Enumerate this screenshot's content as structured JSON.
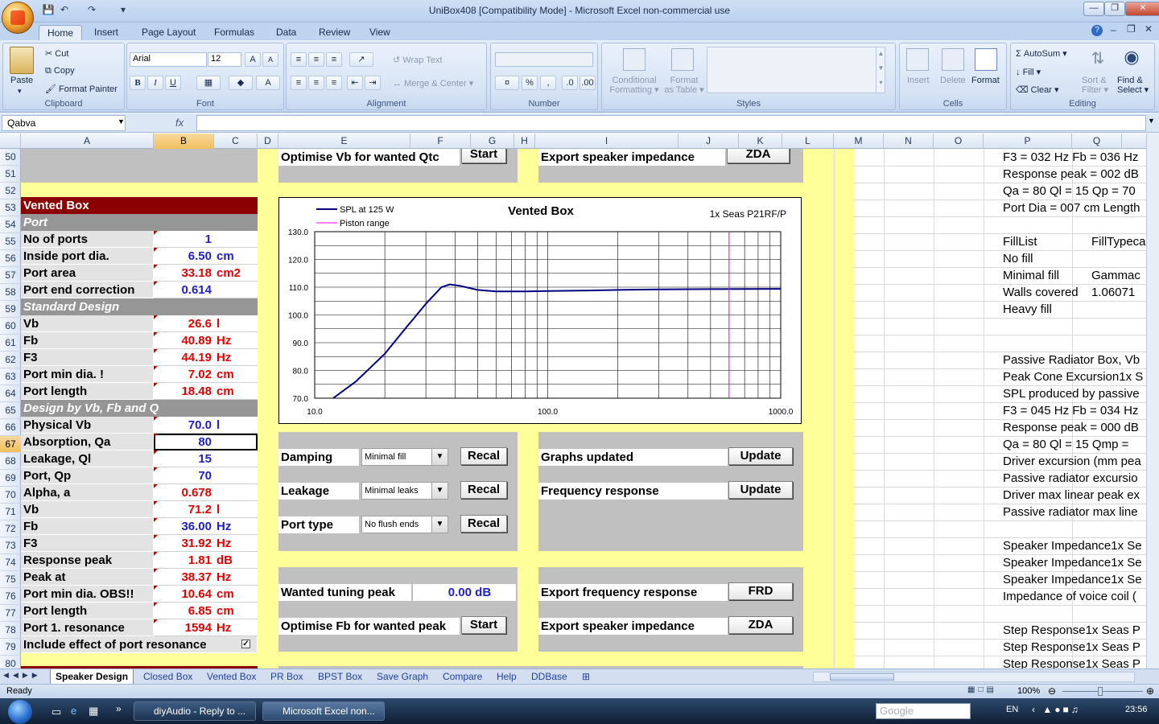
{
  "window": {
    "title": "UniBox408  [Compatibility Mode] - Microsoft Excel non-commercial use"
  },
  "ribbon": {
    "tabs": [
      "Home",
      "Insert",
      "Page Layout",
      "Formulas",
      "Data",
      "Review",
      "View"
    ],
    "clipboard": {
      "label": "Clipboard",
      "paste": "Paste",
      "cut": "Cut",
      "copy": "Copy",
      "format_painter": "Format Painter"
    },
    "font": {
      "label": "Font",
      "name": "Arial",
      "size": "12",
      "bold": "B",
      "italic": "I",
      "underline": "U"
    },
    "alignment": {
      "label": "Alignment",
      "wrap": "Wrap Text",
      "merge": "Merge & Center"
    },
    "number": {
      "label": "Number",
      "percent": "%",
      "comma": ","
    },
    "styles": {
      "label": "Styles",
      "conditional": "Conditional",
      "formatting": "Formatting",
      "format_as": "Format",
      "as_table": "as Table"
    },
    "cells": {
      "label": "Cells",
      "insert": "Insert",
      "delete": "Delete",
      "format": "Format"
    },
    "editing": {
      "label": "Editing",
      "autosum": "AutoSum",
      "fill": "Fill",
      "clear": "Clear",
      "sort": "Sort &",
      "filter": "Filter",
      "find": "Find &",
      "select": "Select"
    }
  },
  "formula_bar": {
    "name_box": "Qabva",
    "fx": "fx",
    "formula": ""
  },
  "columns": [
    "A",
    "B",
    "C",
    "D",
    "E",
    "F",
    "G",
    "H",
    "I",
    "J",
    "K",
    "L",
    "M",
    "N",
    "O",
    "P",
    "Q"
  ],
  "rows": [
    "50",
    "51",
    "52",
    "53",
    "54",
    "55",
    "56",
    "57",
    "58",
    "59",
    "60",
    "61",
    "62",
    "63",
    "64",
    "65",
    "66",
    "67",
    "68",
    "69",
    "70",
    "71",
    "72",
    "73",
    "74",
    "75",
    "76",
    "77",
    "78",
    "79",
    "80"
  ],
  "left_table": [
    {
      "type": "header_red",
      "label": "Vented Box"
    },
    {
      "type": "header_gray",
      "label": "Port"
    },
    {
      "label": "No of ports",
      "value": "1",
      "unit": "",
      "color": "blue"
    },
    {
      "label": "Inside port dia.",
      "value": "6.50",
      "unit": "cm",
      "color": "blue"
    },
    {
      "label": "Port area",
      "value": "33.18",
      "unit": "cm2",
      "color": "red"
    },
    {
      "label": "Port end correction",
      "value": "0.614",
      "unit": "",
      "color": "blue"
    },
    {
      "type": "header_gray",
      "label": "Standard Design"
    },
    {
      "label": "Vb",
      "value": "26.6",
      "unit": "l",
      "color": "red"
    },
    {
      "label": "Fb",
      "value": "40.89",
      "unit": "Hz",
      "color": "red"
    },
    {
      "label": "F3",
      "value": "44.19",
      "unit": "Hz",
      "color": "red"
    },
    {
      "label": "Port min dia. !",
      "value": "7.02",
      "unit": "cm",
      "color": "red"
    },
    {
      "label": "Port length",
      "value": "18.48",
      "unit": "cm",
      "color": "red"
    },
    {
      "type": "header_gray",
      "label": "Design by Vb, Fb and Q"
    },
    {
      "label": "Physical Vb",
      "value": "70.0",
      "unit": "l",
      "color": "blue"
    },
    {
      "label": "Absorption, Qa",
      "value": "80",
      "unit": "",
      "color": "blue",
      "selected": true
    },
    {
      "label": "Leakage, Ql",
      "value": "15",
      "unit": "",
      "color": "blue"
    },
    {
      "label": "Port, Qp",
      "value": "70",
      "unit": "",
      "color": "blue"
    },
    {
      "label": "Alpha, a",
      "value": "0.678",
      "unit": "",
      "color": "red"
    },
    {
      "label": "Vb",
      "value": "71.2",
      "unit": "l",
      "color": "red"
    },
    {
      "label": "Fb",
      "value": "36.00",
      "unit": "Hz",
      "color": "blue"
    },
    {
      "label": "F3",
      "value": "31.92",
      "unit": "Hz",
      "color": "red"
    },
    {
      "label": "Response peak",
      "value": "1.81",
      "unit": "dB",
      "color": "red"
    },
    {
      "label": "Peak at",
      "value": "38.37",
      "unit": "Hz",
      "color": "red"
    },
    {
      "label": "Port min dia. OBS!!",
      "value": "10.64",
      "unit": "cm",
      "color": "red"
    },
    {
      "label": "Port length",
      "value": "6.85",
      "unit": "cm",
      "color": "red"
    },
    {
      "label": "Port 1. resonance",
      "value": "1594",
      "unit": "Hz",
      "color": "red"
    },
    {
      "label": "Include effect of port resonance",
      "value": "",
      "unit": "",
      "color": "blue",
      "checkbox": true
    }
  ],
  "controls": {
    "optimise_vb": "Optimise Vb for wanted Qtc",
    "start": "Start",
    "export_impedance": "Export speaker impedance",
    "zda": "ZDA",
    "damping": "Damping",
    "damping_value": "Minimal fill",
    "leakage": "Leakage",
    "leakage_value": "Minimal leaks",
    "port_type": "Port type",
    "port_type_value": "No flush ends",
    "recal": "Recal",
    "graphs_updated": "Graphs updated",
    "update": "Update",
    "frequency_response": "Frequency response",
    "wanted_peak": "Wanted tuning peak",
    "wanted_peak_value": "0.00",
    "wanted_peak_unit": "dB",
    "export_freq": "Export frequency response",
    "frd": "FRD",
    "optimise_fb": "Optimise Fb for wanted peak"
  },
  "right_column": [
    {
      "row": 0,
      "text": "F3 = 032 Hz  Fb = 036 Hz"
    },
    {
      "row": 1,
      "text": "Response peak = 002 dB"
    },
    {
      "row": 2,
      "text": "Qa = 80  Ql = 15  Qp = 70"
    },
    {
      "row": 3,
      "text": "Port Dia = 007 cm  Length"
    },
    {
      "row": 5,
      "text": "FillList",
      "text2": "FillTypeca"
    },
    {
      "row": 6,
      "text": "No fill"
    },
    {
      "row": 7,
      "text": "Minimal fill",
      "text2": "Gammac"
    },
    {
      "row": 8,
      "text": "Walls covered",
      "text2": "1.06071"
    },
    {
      "row": 9,
      "text": "Heavy fill"
    },
    {
      "row": 12,
      "text": "Passive Radiator Box, Vb"
    },
    {
      "row": 13,
      "text": "Peak Cone Excursion1x S"
    },
    {
      "row": 14,
      "text": "SPL produced by passive"
    },
    {
      "row": 15,
      "text": "F3 = 045 Hz  Fb = 034 Hz"
    },
    {
      "row": 16,
      "text": "Response peak = 000 dB"
    },
    {
      "row": 17,
      "text": "Qa = 80  Ql = 15  Qmp ="
    },
    {
      "row": 18,
      "text": "Driver excursion (mm pea"
    },
    {
      "row": 19,
      "text": "Passive radiator excursio"
    },
    {
      "row": 20,
      "text": "Driver max linear peak ex"
    },
    {
      "row": 21,
      "text": "Passive radiator max line"
    },
    {
      "row": 23,
      "text": "Speaker Impedance1x Se"
    },
    {
      "row": 24,
      "text": "Speaker Impedance1x Se"
    },
    {
      "row": 25,
      "text": "Speaker Impedance1x Se"
    },
    {
      "row": 26,
      "text": "Impedance of voice coil ("
    },
    {
      "row": 28,
      "text": "Step Response1x Seas P"
    },
    {
      "row": 29,
      "text": "Step Response1x Seas P"
    },
    {
      "row": 30,
      "text": "Step Response1x Seas P"
    }
  ],
  "chart_data": {
    "type": "line",
    "title": "Vented Box",
    "subtitle": "1x Seas P21RF/P",
    "legend_position": "top-left",
    "xscale": "log",
    "xlim": [
      10,
      1000
    ],
    "ylim": [
      70,
      130
    ],
    "xticks": [
      "10.0",
      "100.0",
      "1000.0"
    ],
    "yticks": [
      "130.0",
      "120.0",
      "110.0",
      "100.0",
      "90.0",
      "80.0",
      "70.0"
    ],
    "grid": true,
    "series": [
      {
        "name": "SPL at 125 W",
        "color": "#000080",
        "x": [
          12,
          15,
          20,
          25,
          30,
          35,
          38,
          42,
          50,
          60,
          80,
          100,
          150,
          200,
          300,
          500,
          1000
        ],
        "y": [
          70,
          76,
          86,
          96,
          104,
          110,
          111,
          110.5,
          109,
          108.5,
          108.5,
          108.6,
          108.8,
          109,
          109.2,
          109.3,
          109.4
        ]
      },
      {
        "name": "Piston range",
        "color": "#ff00ff",
        "x": [
          600,
          600
        ],
        "y": [
          70,
          130
        ]
      }
    ]
  },
  "sheet_tabs": [
    "Speaker Design",
    "Closed Box",
    "Vented Box",
    "PR Box",
    "BPST Box",
    "Save Graph",
    "Compare",
    "Help",
    "DDBase"
  ],
  "status": {
    "left": "Ready",
    "zoom": "100%"
  },
  "taskbar": {
    "items": [
      "diyAudio - Reply to ...",
      "Microsoft Excel non..."
    ],
    "lang": "EN",
    "time": "23:56",
    "search": "Google"
  }
}
